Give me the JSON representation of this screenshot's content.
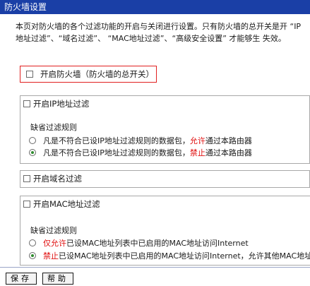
{
  "title": "防火墙设置",
  "intro": "本页对防火墙的各个过滤功能的开启与关闭进行设置。只有防火墙的总开关是开 “IP地址过滤”、“域名过滤”、 “MAC地址过滤”、“高级安全设置” 才能够生 失效。",
  "master": {
    "label": "开启防火墙（防火墙的总开关）"
  },
  "ip_filter": {
    "label": "开启IP地址过滤",
    "rules_title": "缺省过滤规则",
    "options": [
      {
        "prefix": "凡是不符合已设IP地址过滤规则的数据包，",
        "action": "允许",
        "suffix": "通过本路由器"
      },
      {
        "prefix": "凡是不符合已设IP地址过滤规则的数据包，",
        "action": "禁止",
        "suffix": "通过本路由器"
      }
    ]
  },
  "domain_filter": {
    "label": "开启域名过滤"
  },
  "mac_filter": {
    "label": "开启MAC地址过滤",
    "rules_title": "缺省过滤规则",
    "options": [
      {
        "prefix": "",
        "action": "仅允许",
        "suffix": "已设MAC地址列表中已启用的MAC地址访问Internet"
      },
      {
        "prefix": "",
        "action": "禁止",
        "suffix": "已设MAC地址列表中已启用的MAC地址访问Internet，允许其他MAC地址"
      }
    ]
  },
  "buttons": {
    "save": "保存",
    "help": "帮助"
  }
}
